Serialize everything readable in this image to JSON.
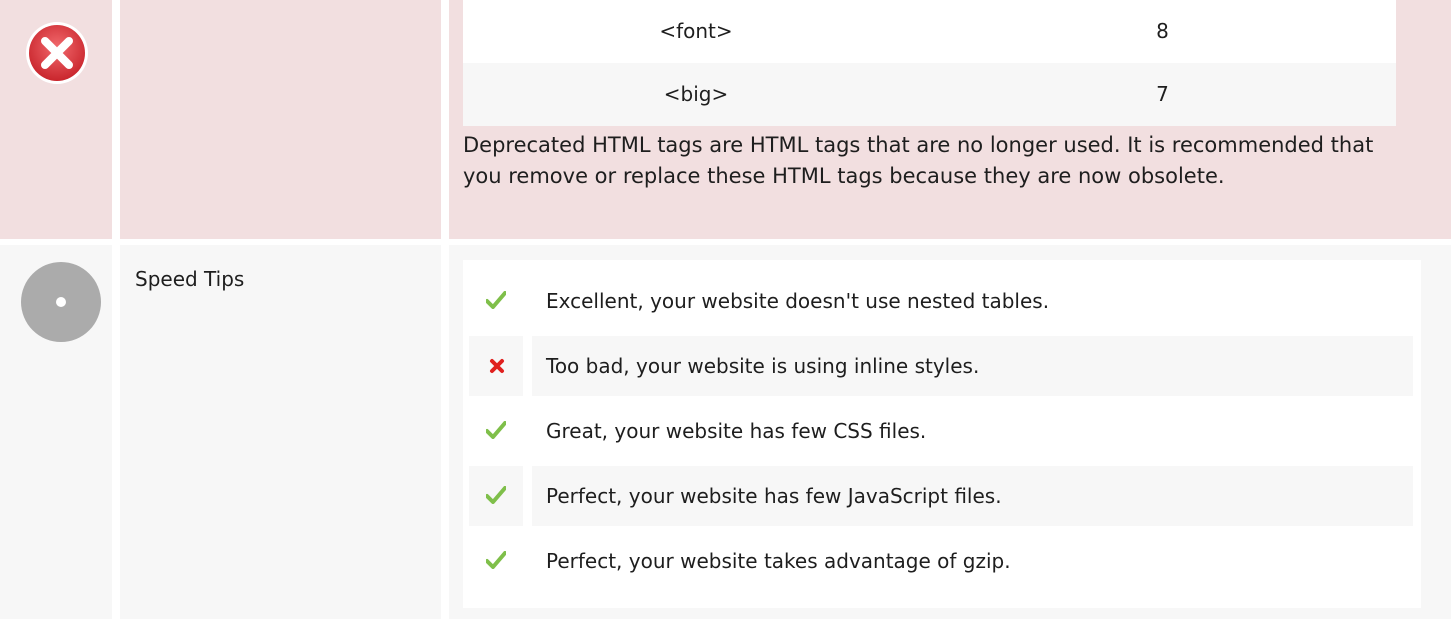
{
  "deprecated": {
    "status_icon": "error-icon",
    "label": "",
    "tags": [
      {
        "tag": "<font>",
        "count": "8"
      },
      {
        "tag": "<big>",
        "count": "7"
      }
    ],
    "description": "Deprecated HTML tags are HTML tags that are no longer used. It is recommended that you remove or replace these HTML tags because they are now obsolete."
  },
  "speed_tips": {
    "status_icon": "neutral-icon",
    "label": "Speed Tips",
    "items": [
      {
        "icon": "check-icon",
        "text": "Excellent, your website doesn't use nested tables."
      },
      {
        "icon": "cross-icon",
        "text": "Too bad, your website is using inline styles."
      },
      {
        "icon": "check-icon",
        "text": "Great, your website has few CSS files."
      },
      {
        "icon": "check-icon",
        "text": "Perfect, your website has few JavaScript files."
      },
      {
        "icon": "check-icon",
        "text": "Perfect, your website takes advantage of gzip."
      }
    ]
  },
  "colors": {
    "error_bg": "#f2dfe0",
    "neutral_bg": "#f7f7f7",
    "check": "#7fbf4a",
    "cross": "#e0201e",
    "error_icon": "#d8333a"
  }
}
